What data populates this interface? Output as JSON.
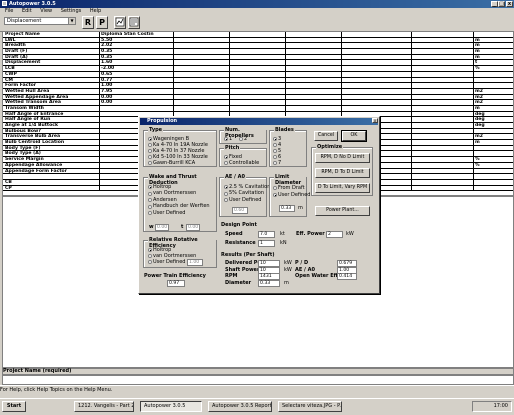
{
  "window": {
    "title": "Autopower 3.0.5",
    "minimize": "_",
    "maximize": "□",
    "close": "x"
  },
  "menu": [
    "File",
    "Edit",
    "View",
    "Settings",
    "Help"
  ],
  "toolbar": {
    "combo_value": "Displacement",
    "btn_r": "R",
    "btn_p": "P"
  },
  "grid": {
    "rows": [
      {
        "label": "Project Name",
        "value": "Diploma Stan Costin",
        "unit": ""
      },
      {
        "label": "LWL",
        "value": "5.50",
        "unit": "m"
      },
      {
        "label": "Breadth",
        "value": "2.02",
        "unit": "m"
      },
      {
        "label": "Draft (F)",
        "value": "0.35",
        "unit": "m"
      },
      {
        "label": "Draft (A)",
        "value": "0.35",
        "unit": "m"
      },
      {
        "label": "Displacement",
        "value": "1.60",
        "unit": "t"
      },
      {
        "label": "LCB",
        "value": "-2.00",
        "unit": "%"
      },
      {
        "label": "CWP",
        "value": "0.65",
        "unit": ""
      },
      {
        "label": "CM",
        "value": "0.77",
        "unit": ""
      },
      {
        "label": "Form Factor",
        "value": "1.00",
        "unit": ""
      },
      {
        "label": "Wetted Hull Area",
        "value": "7.95",
        "unit": "m2"
      },
      {
        "label": "Wetted Appendage Area",
        "value": "0.00",
        "unit": "m2"
      },
      {
        "label": "Wetted Transom Area",
        "value": "0.00",
        "unit": "m2"
      },
      {
        "label": "Transom Width",
        "value": "",
        "unit": "m"
      },
      {
        "label": "Half Angle of Entrance",
        "value": "",
        "unit": "deg"
      },
      {
        "label": "Half Angle of Run",
        "value": "",
        "unit": "deg"
      },
      {
        "label": "Angle at 1/4 Buttock",
        "value": "",
        "unit": "deg"
      },
      {
        "label": "Bulbous Bow?",
        "value": "",
        "unit": ""
      },
      {
        "label": "Transverse Bulb Area",
        "value": "",
        "unit": "m2"
      },
      {
        "label": "Bulb Centroid Location",
        "value": "",
        "unit": "m"
      },
      {
        "label": "Body Type (F)",
        "value": "",
        "unit": ""
      },
      {
        "label": "Body Type (A)",
        "value": "",
        "unit": ""
      },
      {
        "label": "Service Margin",
        "value": "",
        "unit": "%"
      },
      {
        "label": "Appendage Allowance",
        "value": "",
        "unit": "%"
      },
      {
        "label": "Appendage Form Factor",
        "value": "",
        "unit": ""
      },
      {
        "label": "",
        "value": "",
        "unit": ""
      },
      {
        "label": "CB",
        "value": "",
        "unit": ""
      },
      {
        "label": "CP",
        "value": "",
        "unit": ""
      }
    ]
  },
  "project_bar": "Project Name (required)",
  "status": "For Help, click Help Topics on the Help Menu.",
  "taskbar": {
    "start": "Start",
    "buttons": [
      "1212. Vangelis - Part 2 -...",
      "Autopower 3.0.5",
      "Autopower 3.0.5 Report",
      "Selectare viteza.JPG - P..."
    ],
    "clock": "17:00"
  },
  "dialog": {
    "title": "Propulsion",
    "type": {
      "title": "Type",
      "options": [
        "Wageningen B",
        "Ka 4-70 In 19A Nozzle",
        "Ka 4-70 In 37 Nozzle",
        "Kd 5-100 In 33 Nozzle",
        "Gawn-Burrill KCA"
      ]
    },
    "num_props": {
      "title": "Num. Propellers",
      "options": [
        "1",
        "2"
      ]
    },
    "pitch": {
      "title": "Pitch",
      "options": [
        "Fixed",
        "Controllable"
      ]
    },
    "blades": {
      "title": "Blades",
      "options": [
        "3",
        "4",
        "5",
        "6",
        "7"
      ]
    },
    "wake": {
      "title": "Wake and Thrust Deduction",
      "options": [
        "Holtrop",
        "van Oortmerssen",
        "Andersen",
        "Handbuch der Werften",
        "User Defined"
      ],
      "w_label": "w",
      "w_value": "0.00",
      "t_label": "t",
      "t_value": "0.00"
    },
    "ae_ao": {
      "title": "AE / A0",
      "options": [
        "2.5 % Cavitation",
        "5% Cavitation",
        "User Defined"
      ],
      "value": "0.60"
    },
    "limit_diam": {
      "title": "Limit Diameter",
      "options": [
        "From Draft",
        "User Defined"
      ],
      "value": "0.33",
      "unit": "m"
    },
    "rre": {
      "title": "Relative Rotative Efficiency",
      "options": [
        "Holtrop",
        "van Oortmerssen",
        "User Defined"
      ],
      "value": "1.00"
    },
    "ptrain": {
      "title": "Power Train Efficiency",
      "value": "0.97"
    },
    "design_point": {
      "title": "Design Point",
      "speed_label": "Speed",
      "speed_value": "7.0",
      "speed_unit": "kt",
      "resistance_label": "Resistance",
      "resistance_value": "1",
      "resistance_unit": "kN",
      "effpower_label": "Eff. Power",
      "effpower_value": "2",
      "effpower_unit": "kW"
    },
    "results": {
      "title": "Results (Per Shaft)",
      "rows": [
        {
          "label": "Delivered Power",
          "value": "10",
          "unit": "kW"
        },
        {
          "label": "Shaft Power",
          "value": "10",
          "unit": "kW"
        },
        {
          "label": "RPM",
          "value": "1431",
          "unit": ""
        },
        {
          "label": "Diameter",
          "value": "0.33",
          "unit": "m"
        }
      ],
      "right": [
        {
          "label": "P / D",
          "value": "0.679"
        },
        {
          "label": "AE / A0",
          "value": "1.00"
        },
        {
          "label": "Open Water Eff.",
          "value": "0.414"
        }
      ]
    },
    "buttons": {
      "cancel": "Cancel",
      "ok": "OK",
      "optimize": "Optimize",
      "rpm_nod": "RPM, D No D Limit",
      "rpm_d": "RPM, D To D Limit",
      "d_limit": "D To Limit, Vary RPM",
      "power_plant": "Power Plant..."
    }
  }
}
